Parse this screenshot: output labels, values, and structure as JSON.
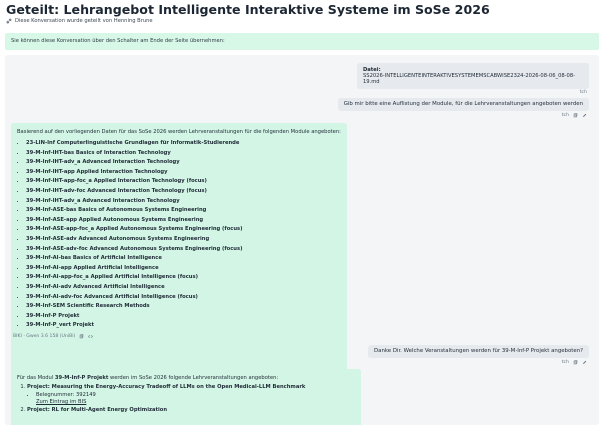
{
  "header": {
    "title": "Geteilt: Lehrangebot Intelligente Interaktive Systeme im SoSe 2026",
    "shared_by": "Diese Konversation wurde geteilt von Henning Brune"
  },
  "notice": "Sie können diese Konversation über den Schalter am Ende der Seite übernehmen:",
  "file_message": {
    "label": "Datei:",
    "filename": "SS2026-INTELLIGENTEINTERAKTIVESYSTEMEMSCABWISE2324-2026-08-06_08-08-19.md",
    "author": "tch"
  },
  "user_message_1": {
    "text": "Gib mir bitte eine Auflistung der Module, für die Lehrveranstaltungen angeboten werden",
    "author": "tch"
  },
  "ai_message_1": {
    "intro": "Basierend auf den vorliegenden Daten für das SoSe 2026 werden Lehrveranstaltungen für die folgenden Module angeboten:",
    "modules": [
      "23-LIN-Inf Computerlinguistische Grundlagen für Informatik-Studierende",
      "39-M-Inf-IHT-bas Basics of Interaction Technology",
      "39-M-Inf-IHT-adv_a Advanced Interaction Technology",
      "39-M-Inf-IHT-app Applied Interaction Technology",
      "39-M-Inf-IHT-app-foc_a Applied Interaction Technology (focus)",
      "39-M-Inf-IHT-adv-foc Advanced Interaction Technology (focus)",
      "39-M-Inf-IHT-adv_a Advanced Interaction Technology",
      "39-M-Inf-ASE-bas Basics of Autonomous Systems Engineering",
      "39-M-Inf-ASE-app Applied Autonomous Systems Engineering",
      "39-M-Inf-ASE-app-foc_a Applied Autonomous Systems Engineering (focus)",
      "39-M-Inf-ASE-adv Advanced Autonomous Systems Engineering",
      "39-M-Inf-ASE-adv-foc Advanced Autonomous Systems Engineering (focus)",
      "39-M-Inf-AI-bas Basics of Artificial Intelligence",
      "39-M-Inf-AI-app Applied Artificial Intelligence",
      "39-M-Inf-AI-app-foc_a Applied Artificial Intelligence (focus)",
      "39-M-Inf-AI-adv Advanced Artificial Intelligence",
      "39-M-Inf-AI-adv-foc Advanced Artificial Intelligence (focus)",
      "39-M-Inf-SEM Scientific Research Methods",
      "39-M-Inf-P Projekt",
      "39-M-Inf-P_vert Projekt"
    ],
    "meta": "BIKI · Gwen 3.6 158 (UniBi)"
  },
  "user_message_2": {
    "text": "Danke Dir. Welche Veranstaltungen werden für 39-M-Inf-P Projekt angeboten?",
    "author": "tch"
  },
  "ai_message_2": {
    "intro_pre": "Für das Modul ",
    "intro_bold": "39-M-Inf-P Projekt",
    "intro_post": " werden im SoSe 2026 folgende Lehrveranstaltungen angeboten:",
    "items": [
      {
        "title": "Project: Measuring the Energy-Accuracy Tradeoff of LLMs on the Open Medical-LLM Benchmark",
        "belegnummer_label": "Belegnummer: 392149",
        "link": "Zum Eintrag im BIS"
      },
      {
        "title": "Project: RL for Multi-Agent Energy Optimization"
      }
    ]
  },
  "colors": {
    "notice_bg": "#d7f7e7",
    "ai_bubble_bg": "#d3f5e5",
    "user_bubble_bg": "#e6e9ed",
    "chat_bg": "#f3f5f7"
  }
}
